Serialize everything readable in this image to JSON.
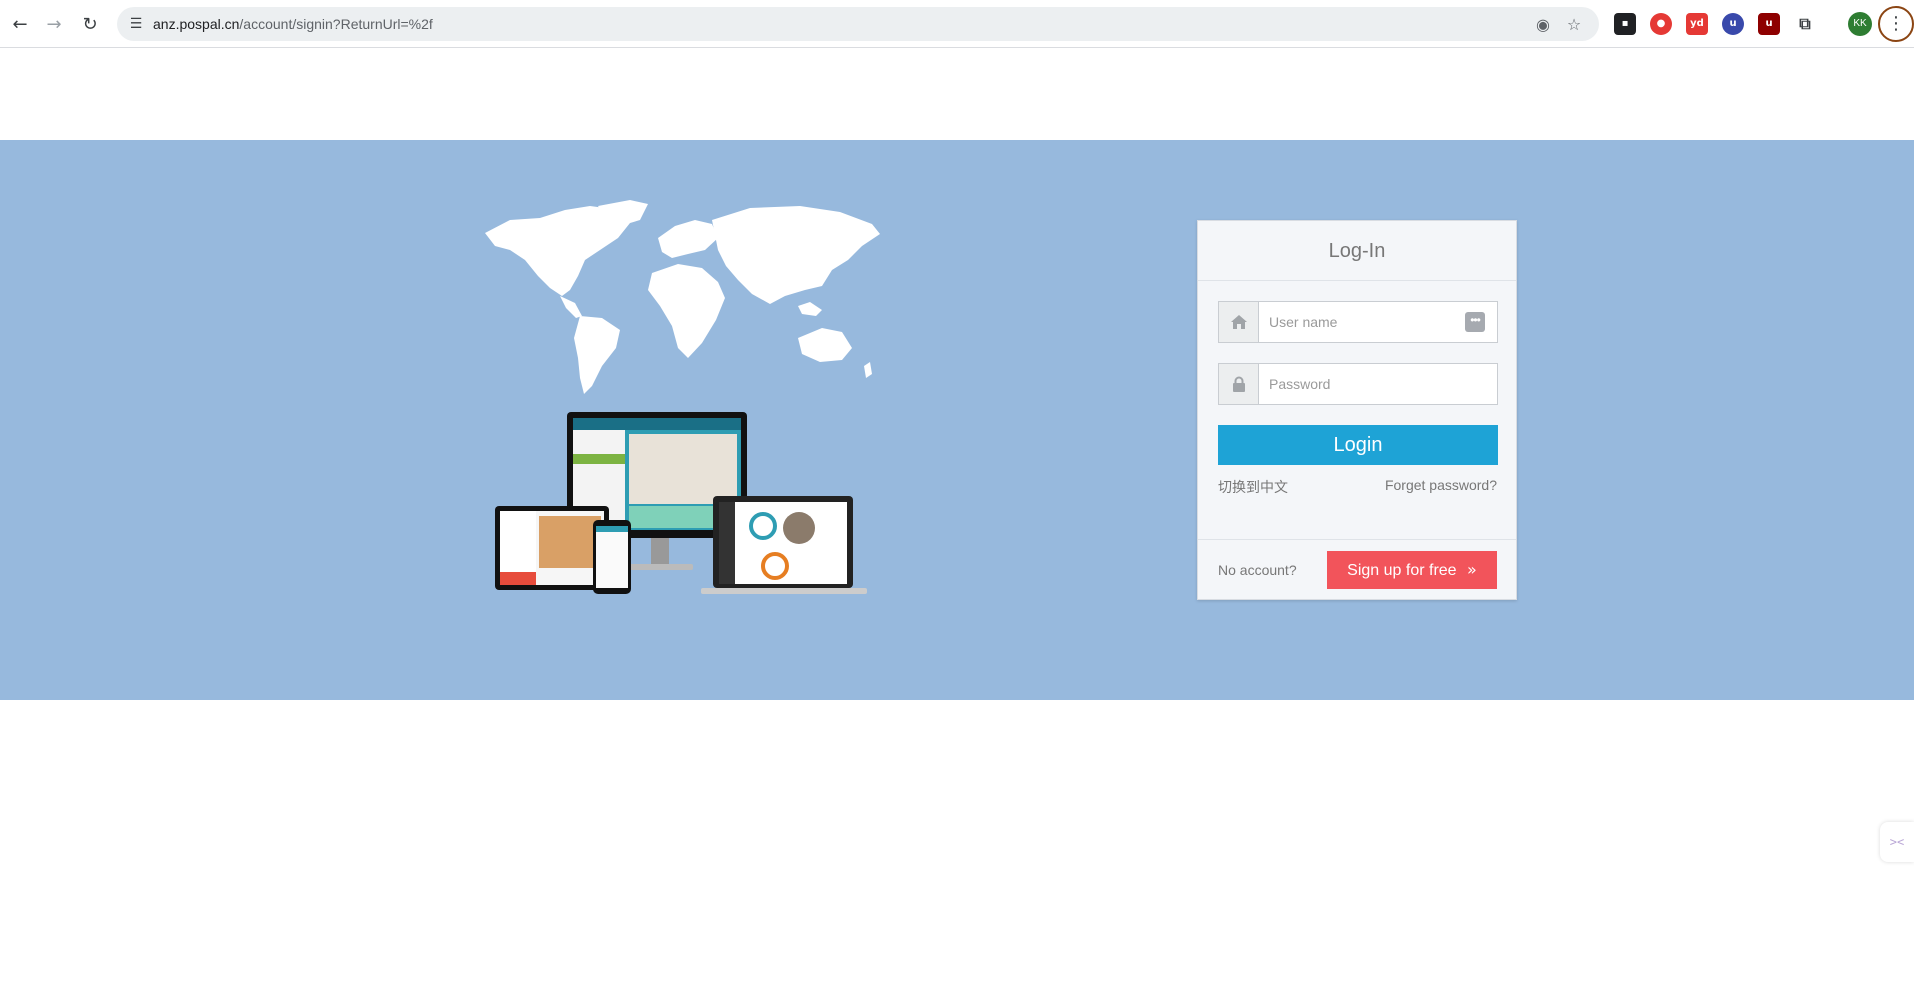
{
  "browser": {
    "url_host": "anz.pospal.cn",
    "url_path": "/account/signin?ReturnUrl=%2f",
    "profile_initials": "KK",
    "extensions": [
      "ext-1",
      "ext-2",
      "yd",
      "ub",
      "ub2",
      "puzzle"
    ]
  },
  "login": {
    "title": "Log-In",
    "username_placeholder": "User name",
    "password_placeholder": "Password",
    "login_label": "Login",
    "switch_language": "切换到中文",
    "forget_password": "Forget password?",
    "no_account": "No account?",
    "signup_label": "Sign up for free"
  },
  "colors": {
    "banner": "#97b9dd",
    "login_button": "#1ea3d6",
    "signup_button": "#f2545b"
  }
}
